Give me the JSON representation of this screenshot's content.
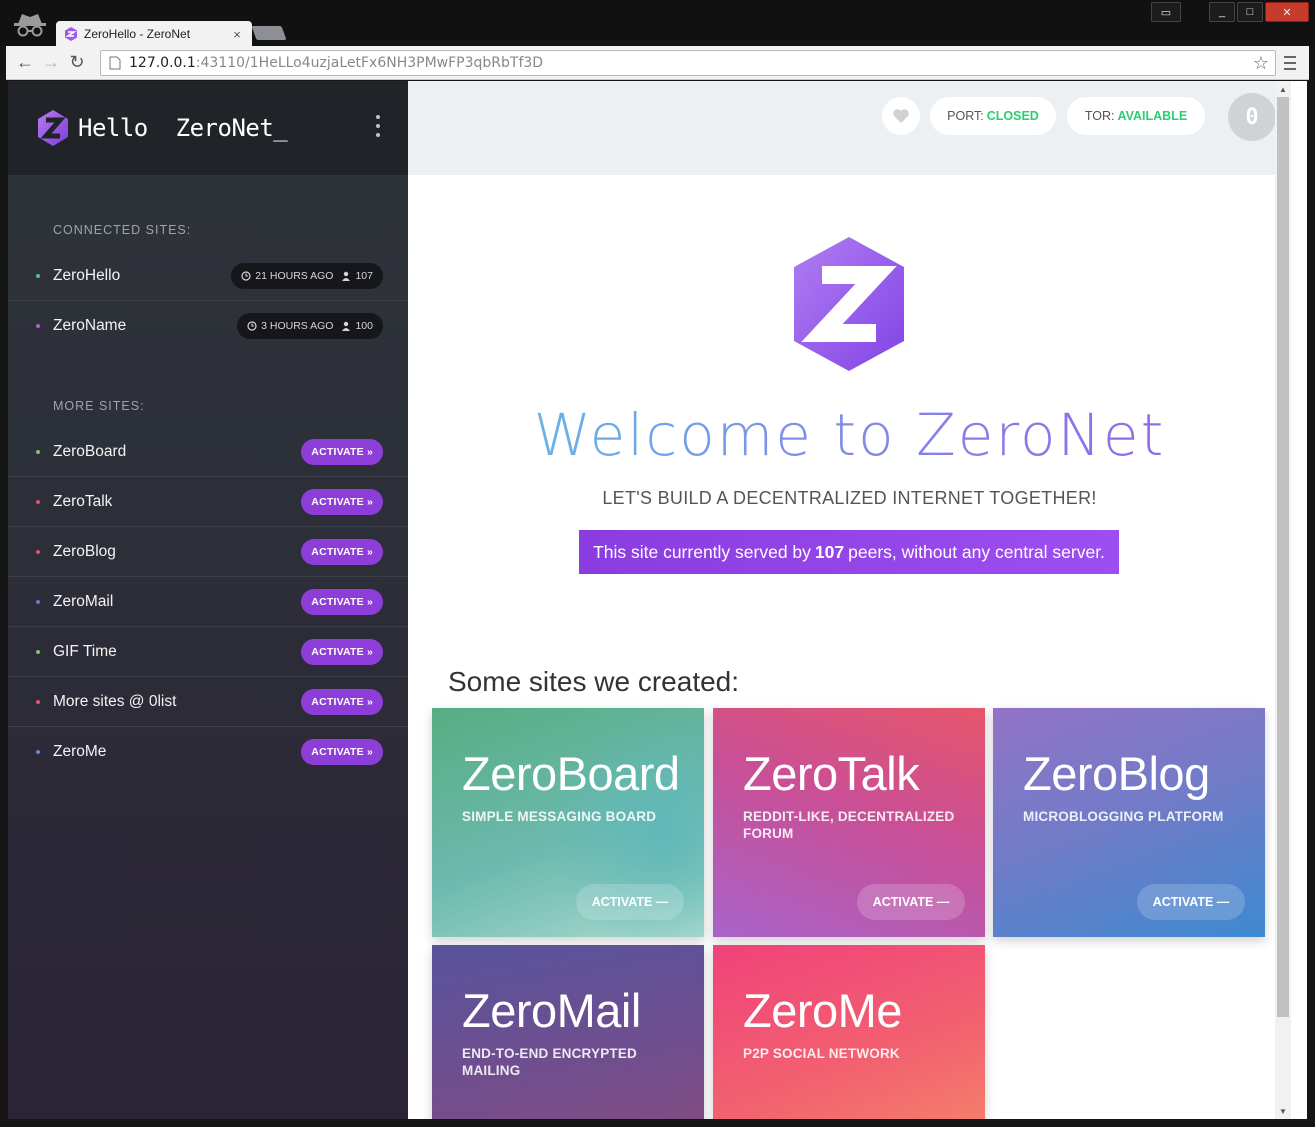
{
  "browser": {
    "tab_title": "ZeroHello - ZeroNet",
    "tab_close": "×",
    "url_host": "127.0.0.1",
    "url_path": ":43110/1HeLLo4uzjaLetFx6NH3PMwFP3qbRbTf3D"
  },
  "sidebar": {
    "title": "Hello  ZeroNet_",
    "connected_label": "CONNECTED SITES:",
    "connected": [
      {
        "name": "ZeroHello",
        "time": "21 HOURS AGO",
        "peers": "107",
        "dot": "#4dc28f"
      },
      {
        "name": "ZeroName",
        "time": "3 HOURS AGO",
        "peers": "100",
        "dot": "#b35fd0"
      }
    ],
    "more_label": "MORE SITES:",
    "activate_label": "ACTIVATE »",
    "more": [
      {
        "name": "ZeroBoard",
        "dot": "#7cc46a"
      },
      {
        "name": "ZeroTalk",
        "dot": "#e05670"
      },
      {
        "name": "ZeroBlog",
        "dot": "#e05670"
      },
      {
        "name": "ZeroMail",
        "dot": "#6a78d8"
      },
      {
        "name": "GIF Time",
        "dot": "#7cc46a"
      },
      {
        "name": "More sites @ 0list",
        "dot": "#e05670"
      },
      {
        "name": "ZeroMe",
        "dot": "#5b8ad8"
      }
    ]
  },
  "topbar": {
    "port_label": "PORT:",
    "port_value": "CLOSED",
    "tor_label": "TOR:",
    "tor_value": "AVAILABLE",
    "notifications": "0"
  },
  "hero": {
    "welcome": "Welcome to ZeroNet",
    "subtitle": "LET'S BUILD A DECENTRALIZED INTERNET TOGETHER!",
    "served_prefix": "This site currently served by",
    "served_peers": "107",
    "served_suffix": "peers, without any central server."
  },
  "created": {
    "title": "Some sites we created:",
    "cards": [
      {
        "title": "ZeroBoard",
        "desc": "SIMPLE MESSAGING BOARD",
        "button": "ACTIVATE —"
      },
      {
        "title": "ZeroTalk",
        "desc": "REDDIT-LIKE, DECENTRALIZED FORUM",
        "button": "ACTIVATE —"
      },
      {
        "title": "ZeroBlog",
        "desc": "MICROBLOGGING PLATFORM",
        "button": "ACTIVATE —"
      },
      {
        "title": "ZeroMail",
        "desc": "END-TO-END ENCRYPTED MAILING"
      },
      {
        "title": "ZeroMe",
        "desc": "P2P SOCIAL NETWORK"
      }
    ]
  },
  "colors": {
    "accent": "#8e3ed8",
    "green": "#2ecc71"
  }
}
